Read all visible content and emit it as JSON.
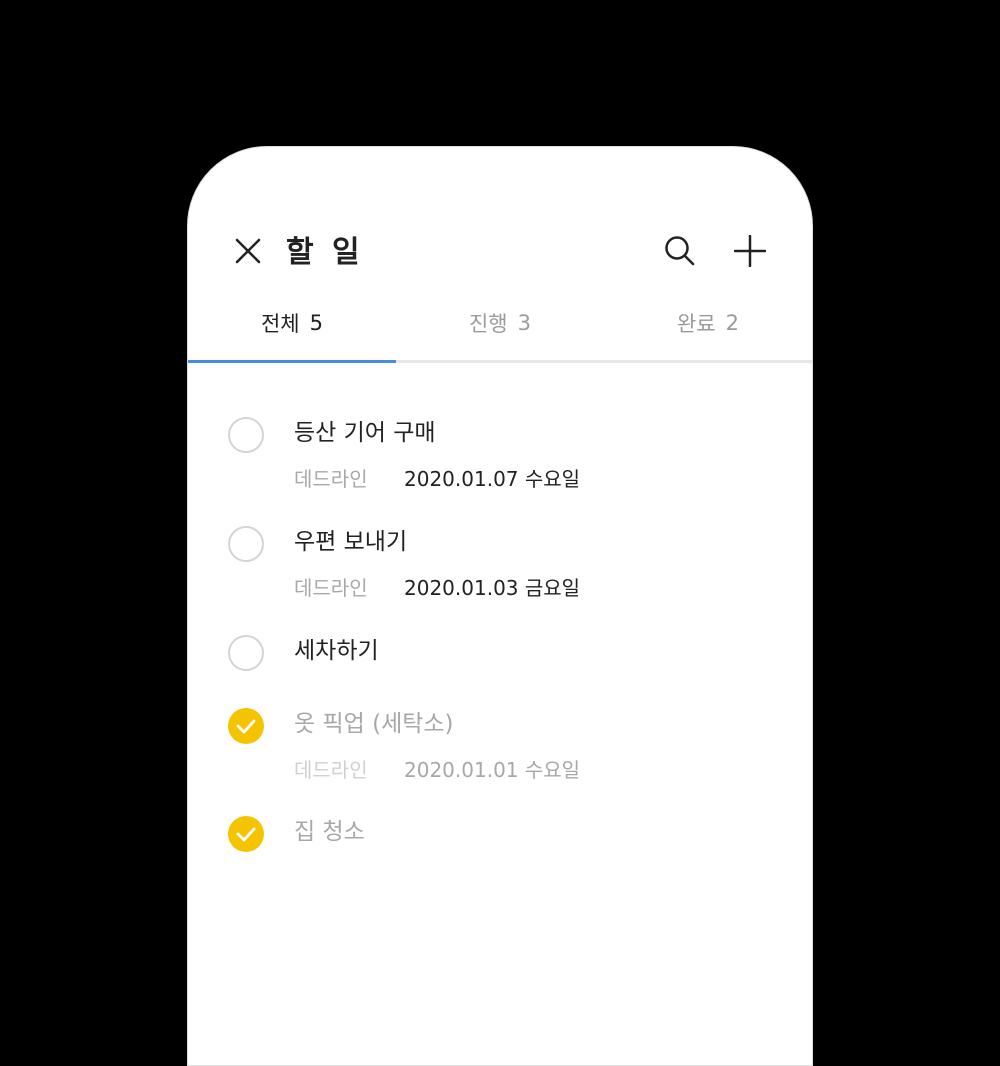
{
  "header": {
    "title": "할 일",
    "close_icon": "close-icon",
    "search_icon": "search-icon",
    "add_icon": "plus-icon"
  },
  "tabs": [
    {
      "label": "전체",
      "count": "5",
      "active": true
    },
    {
      "label": "진행",
      "count": "3",
      "active": false
    },
    {
      "label": "완료",
      "count": "2",
      "active": false
    }
  ],
  "todos": [
    {
      "title": "등산 기어 구매",
      "done": false,
      "deadline_label": "데드라인",
      "deadline": "2020.01.07 수요일"
    },
    {
      "title": "우편 보내기",
      "done": false,
      "deadline_label": "데드라인",
      "deadline": "2020.01.03 금요일"
    },
    {
      "title": "세차하기",
      "done": false
    },
    {
      "title": "옷 픽업 (세탁소)",
      "done": true,
      "deadline_label": "데드라인",
      "deadline": "2020.01.01 수요일"
    },
    {
      "title": "집 청소",
      "done": true
    }
  ],
  "colors": {
    "accent": "#4a8ae0",
    "check_done": "#f5c400",
    "text": "#222222",
    "muted": "#a8a8a8",
    "background": "#000000"
  }
}
